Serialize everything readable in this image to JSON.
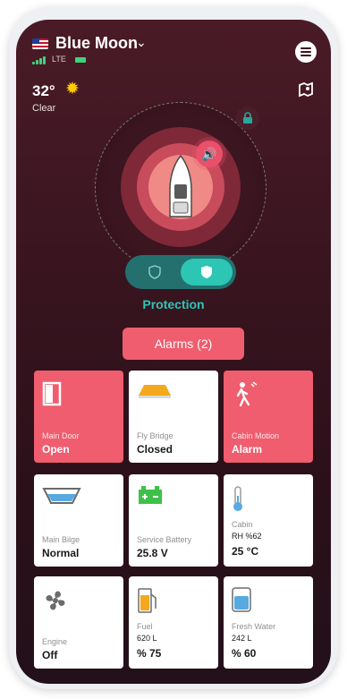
{
  "header": {
    "boat_name": "Blue Moon",
    "network": "LTE",
    "temperature": "32°",
    "weather": "Clear"
  },
  "protection": {
    "label": "Protection"
  },
  "alarms": {
    "label": "Alarms (2)"
  },
  "tiles": [
    {
      "label": "Main Door",
      "value": "Open",
      "alert": true
    },
    {
      "label": "Fly Bridge",
      "value": "Closed",
      "alert": false
    },
    {
      "label": "Cabin Motion",
      "value": "Alarm",
      "alert": true
    },
    {
      "label": "Main Bilge",
      "value": "Normal",
      "alert": false
    },
    {
      "label": "Service Battery",
      "value": "25.8 V",
      "alert": false
    },
    {
      "label": "Cabin",
      "line2": "RH %62",
      "value": "25 °C",
      "alert": false
    },
    {
      "label": "Engine",
      "value": "Off",
      "alert": false
    },
    {
      "label": "Fuel",
      "line2": "620 L",
      "value": "% 75",
      "alert": false
    },
    {
      "label": "Fresh Water",
      "line2": "242 L",
      "value": "% 60",
      "alert": false
    }
  ],
  "colors": {
    "background": "#3a1520",
    "accent_teal": "#2dc6b5",
    "alert_red": "#ef5d6e",
    "signal_green": "#3fd37a"
  },
  "icons": {
    "menu": "hamburger-icon",
    "map": "map-icon",
    "weather": "sun-icon",
    "lock": "lock-icon",
    "siren": "speaker-icon"
  }
}
